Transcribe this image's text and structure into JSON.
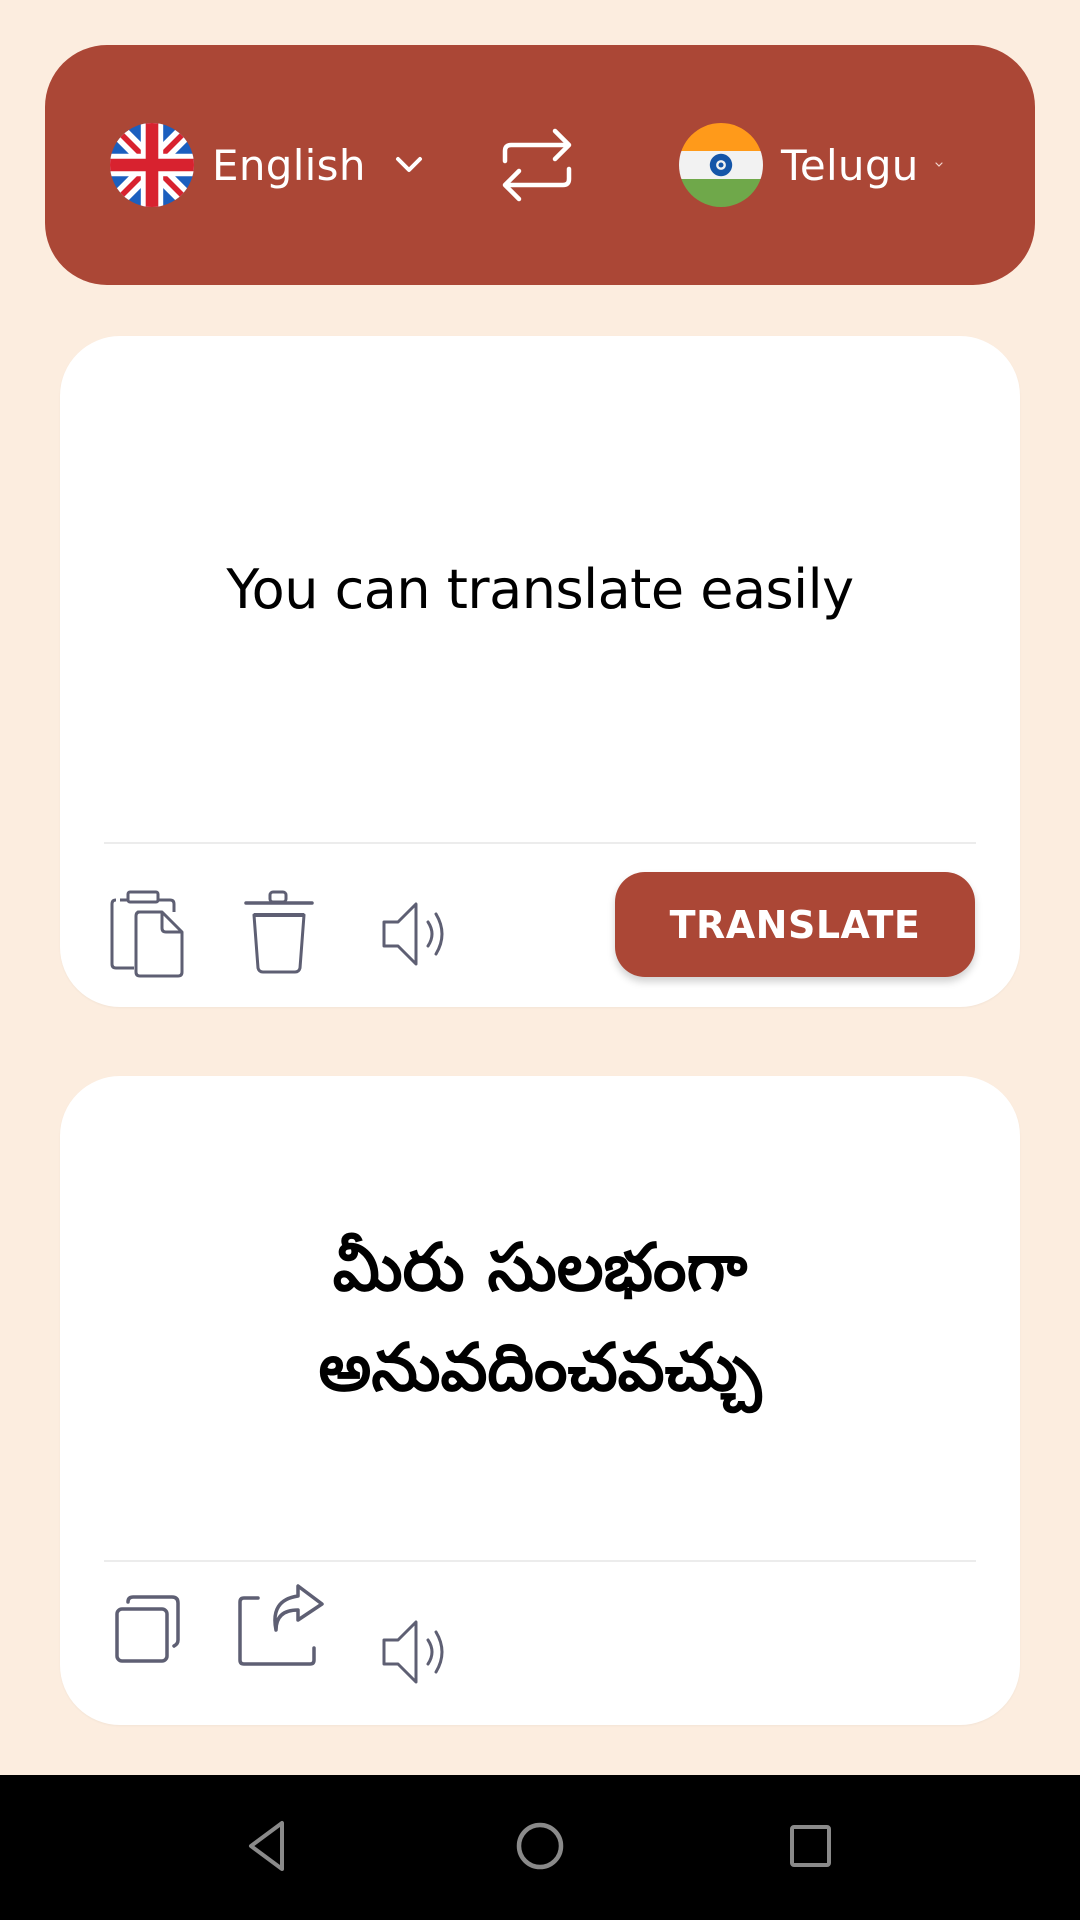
{
  "header": {
    "source_language": {
      "label": "English",
      "flag_icon": "uk-flag-icon",
      "dropdown_icon": "chevron-down-icon"
    },
    "swap_icon": "swap-arrows-icon",
    "target_language": {
      "label": "Telugu",
      "flag_icon": "india-flag-icon",
      "dropdown_icon": "chevron-down-icon"
    }
  },
  "input_card": {
    "text": "You can translate easily",
    "actions": [
      {
        "name": "paste",
        "icon": "clipboard-paste-icon"
      },
      {
        "name": "delete",
        "icon": "trash-icon"
      },
      {
        "name": "speak",
        "icon": "speaker-icon"
      }
    ],
    "translate_label": "TRANSLATE"
  },
  "output_card": {
    "text": "మీరు సులభంగా అనువదించవచ్చు",
    "actions": [
      {
        "name": "copy",
        "icon": "copy-icon"
      },
      {
        "name": "share",
        "icon": "share-icon"
      },
      {
        "name": "speak",
        "icon": "speaker-icon"
      }
    ]
  },
  "navbar": {
    "buttons": [
      {
        "name": "back",
        "icon": "back-triangle-icon"
      },
      {
        "name": "home",
        "icon": "home-circle-icon"
      },
      {
        "name": "recents",
        "icon": "recents-square-icon"
      }
    ]
  },
  "colors": {
    "background": "#FCEDDF",
    "accent": "#AB4736",
    "icon_gray": "#5E5F73",
    "card": "#FFFFFF",
    "navbar": "#000000"
  }
}
